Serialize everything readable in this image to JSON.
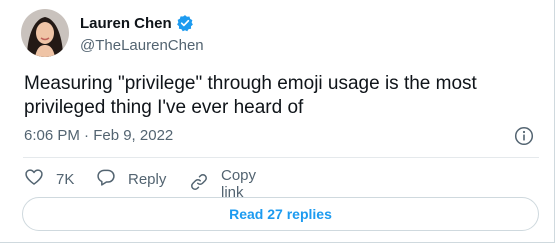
{
  "author": {
    "display_name": "Lauren Chen",
    "handle": "@TheLaurenChen",
    "verified_icon": "verified-badge-icon",
    "avatar": "profile-photo"
  },
  "tweet": {
    "text": "Measuring \"privilege\" through emoji usage is the most privileged thing I've ever heard of",
    "timestamp": "6:06 PM · Feb 9, 2022"
  },
  "actions": {
    "like": {
      "icon": "heart-icon",
      "label": "7K"
    },
    "reply": {
      "icon": "speech-bubble-icon",
      "label": "Reply"
    },
    "copy_link": {
      "icon": "link-icon",
      "label": "Copy link"
    }
  },
  "replies_button": {
    "label": "Read 27 replies"
  },
  "info_icon": "info-icon",
  "colors": {
    "accent": "#1d9bf0",
    "text": "#0f1419",
    "muted": "#536471",
    "border": "#cfd9de"
  }
}
